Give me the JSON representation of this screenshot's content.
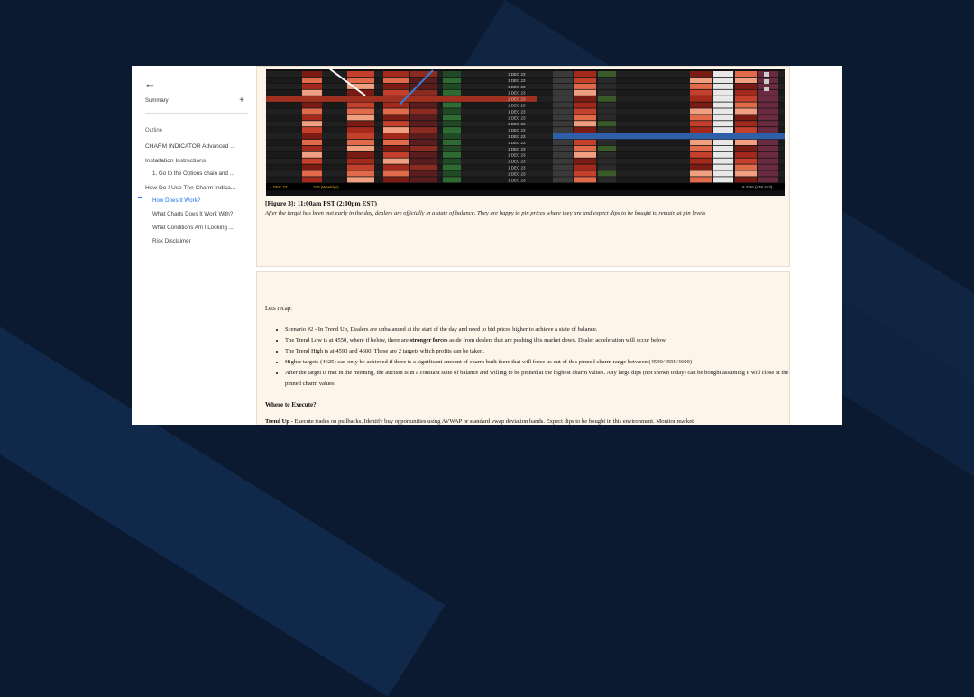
{
  "sidebar": {
    "summary_label": "Summary",
    "add_label": "+",
    "outline_label": "Outline",
    "items": [
      {
        "label": "CHARM INDICATOR Advanced ..."
      },
      {
        "label": "Installation Instructions"
      },
      {
        "label": "1. Go to the Options chain and ..."
      },
      {
        "label": "How Do I Use The Charm Indica..."
      },
      {
        "label": "How Does It Work?"
      },
      {
        "label": "What Charts Does It Work With?"
      },
      {
        "label": "What Conditions Am I Looking ..."
      },
      {
        "label": "Risk Disclaimer"
      }
    ]
  },
  "screenshot": {
    "date_label": "1 DEC 23",
    "footer_left": "4 DEC 23",
    "footer_mid": "100 (Weeklys)",
    "footer_right": "5.43% (±26.413)"
  },
  "figure": {
    "caption": "[Figure 3]: 11:00am PST (2:00pm EST)",
    "description": "After the target has been met early in the day, dealers are officially in a state of balance. They are happy to pin prices where they are and expect dips to be bought to remain at pin levels"
  },
  "recap": {
    "heading": "Lets recap:",
    "bullets": [
      {
        "pre": "Scenario #2 - In Trend Up, Dealers are unbalanced at the start of the day and need to bid prices higher to achieve a state of balance.",
        "bold": "",
        "post": ""
      },
      {
        "pre": "The Trend Low is at 4550, where if below, there are ",
        "bold": "stronger forces",
        "post": " aside from dealers that are pushing this market down. Dealer acceleration will occur below."
      },
      {
        "pre": "The Trend High is at 4590 and 4600. These are 2 targets which profits can be taken.",
        "bold": "",
        "post": ""
      },
      {
        "pre": "Higher targets (4625) can only be achieved if there is a significant amount of charm built there that will force us out of this pinned charm range between (4590/4595/4600)",
        "bold": "",
        "post": ""
      },
      {
        "pre": "After the target is met in the morning, the auction is in a constant state of balance and willing to be pinned at the highest charm values. Any large dips (not shown today) can be bought assuming it will close at the pinned charm values.",
        "bold": "",
        "post": ""
      }
    ],
    "where_heading": "Where to Execute?",
    "trend_bold": "Trend Up",
    "trend_text": " - Execute trades on pullbacks. Identify buy opportunities using AVWAP or standard vwap deviation bands.  Expect dips to be bought in this environment. Monitor market"
  },
  "colors": {
    "background": "#0b1a30",
    "accent": "#1a73e8",
    "page": "#fdf5ea"
  }
}
